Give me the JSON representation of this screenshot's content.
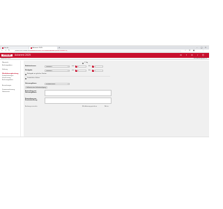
{
  "browser": {
    "tabs": [
      {
        "label": "Sixt.de"
      },
      {
        "label": "Autorent 2025"
      }
    ],
    "url_host": "autoverleih.lexware.de",
    "url_rest": "/#/autorent/2025/CUSTOMER/IDIbNsmEQd2l9lZGvUR4eDTq"
  },
  "app": {
    "brand": "LEXWARE",
    "title": "Autorent 2025",
    "sub_left": "Autorent 2025",
    "sub_right": "Mietfahrzeug buchen"
  },
  "sidebar": {
    "items": [
      {
        "label": "Übersicht"
      },
      {
        "label": "Buchungsdaten"
      },
      {
        "label": "Zahlung"
      },
      {
        "label": "Mietfahrzeugbuchung"
      },
      {
        "label": "Zusatzleistungen"
      },
      {
        "label": "Versicherung"
      },
      {
        "label": "Rechnungsdaten"
      },
      {
        "label": "Bemerkungen"
      },
      {
        "label": "Zusammenfassung"
      },
      {
        "label": "Dokumente"
      }
    ],
    "active_index": 3
  },
  "form": {
    "checkbox_label": "1 Tag",
    "pickup": {
      "label": "Abholzeitraum",
      "location_value": "Flughafen",
      "from_label": "von",
      "to_label": "bis"
    },
    "return": {
      "label": "Rückgabe",
      "location_value": "Flughafen",
      "from_label": "von",
      "to_label": "bis"
    },
    "same_location_label": "Rückgabe an gleicher Station",
    "extra_driver_label": "Zusätzlicher Fahrer",
    "vehicle": {
      "label": "Fahrzeugklasse",
      "value": "Kompaktklasse"
    },
    "insurance_chip": "Vollkasko ohne Selbstbeteiligung",
    "remark_vehicle_label": "Bemerkung zur Fahrzeugklasse",
    "remark_customer_label": "Bemerkung zur Kundenbuchung",
    "btn_cancel": "Buchung verwerfen",
    "btn_save": "Mietfahrzeug speichern",
    "btn_next": "Weiter"
  }
}
